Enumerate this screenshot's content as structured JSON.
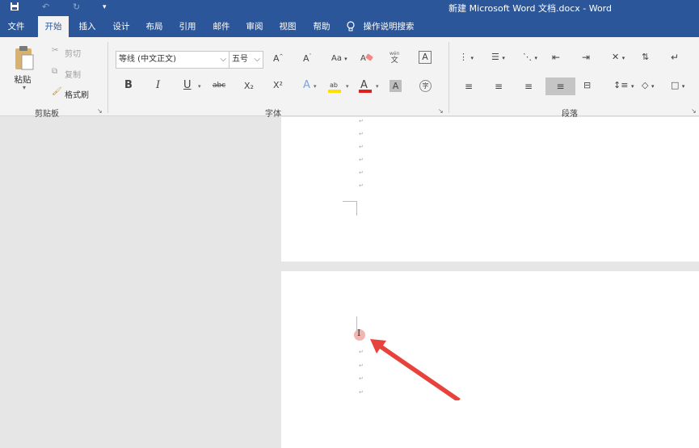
{
  "titlebar": {
    "title": "新建 Microsoft Word 文档.docx  -  Word",
    "save_icon": "save-icon",
    "undo_icon": "undo-icon",
    "redo_icon": "redo-icon",
    "customize_icon": "customize-qa-icon"
  },
  "tabs": [
    {
      "label": "文件"
    },
    {
      "label": "开始"
    },
    {
      "label": "插入"
    },
    {
      "label": "设计"
    },
    {
      "label": "布局"
    },
    {
      "label": "引用"
    },
    {
      "label": "邮件"
    },
    {
      "label": "审阅"
    },
    {
      "label": "视图"
    },
    {
      "label": "帮助"
    }
  ],
  "tell_me": {
    "label": "操作说明搜索"
  },
  "clipboard": {
    "paste_label": "粘贴",
    "cut_label": "剪切",
    "copy_label": "复制",
    "format_painter_label": "格式刷",
    "group_label": "剪贴板"
  },
  "font": {
    "font_name": "等线 (中文正文)",
    "font_size": "五号",
    "group_label": "字体",
    "bold": "B",
    "italic": "I",
    "underline": "U",
    "strike": "abc",
    "subscript": "X₂",
    "superscript": "X²",
    "grow": "A",
    "shrink": "A",
    "change_case": "Aa",
    "font_color_letter": "A",
    "shading_letter": "A",
    "border_letter": "A",
    "highlight_letters": "ab",
    "phonetic_top": "wén",
    "phonetic_char": "文",
    "enclose_char": "字"
  },
  "paragraph": {
    "group_label": "段落"
  },
  "colors": {
    "brand": "#2b579a",
    "arrow": "#e8423c",
    "font_color_bar": "#e0201f",
    "highlight_bar": "#ffe100"
  }
}
